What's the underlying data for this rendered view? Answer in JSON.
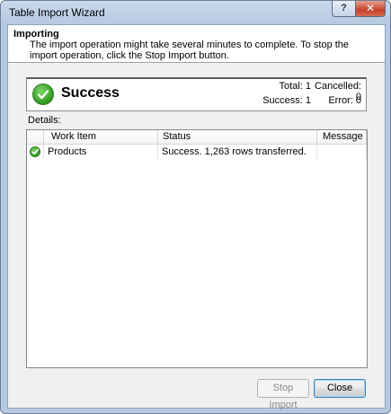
{
  "window": {
    "title": "Table Import Wizard",
    "help_label": "?",
    "close_label": "✕"
  },
  "header": {
    "title": "Importing",
    "description": "The import operation might take several minutes to complete. To stop the import operation, click the Stop Import button."
  },
  "summary": {
    "status": "Success",
    "status_icon": "success-check-icon",
    "total_label": "Total: 1",
    "cancelled_label": "Cancelled: 0",
    "success_label": "Success: 1",
    "error_label": "Error: 0"
  },
  "details": {
    "label": "Details:",
    "columns": [
      "Work Item",
      "Status",
      "Message"
    ],
    "rows": [
      {
        "icon": "success-check-icon",
        "work_item": "Products",
        "status": "Success. 1,263 rows transferred.",
        "message": ""
      }
    ]
  },
  "buttons": {
    "stop_import": "Stop Import",
    "close": "Close"
  },
  "colors": {
    "success_green": "#2f9a1e",
    "title_bar": "#b6c9e2"
  }
}
